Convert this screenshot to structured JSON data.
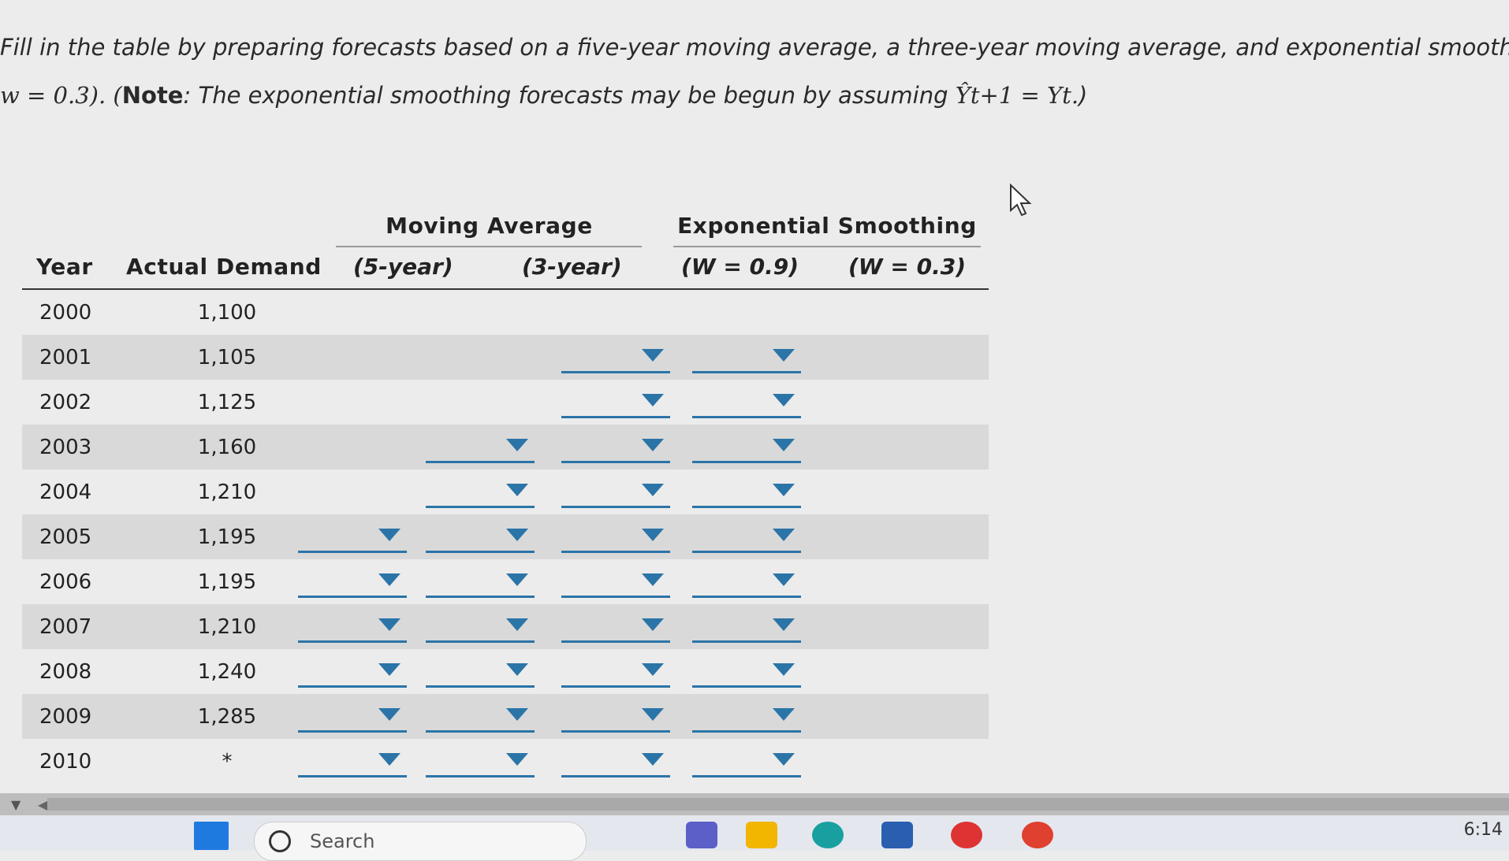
{
  "question": {
    "line1": "Fill in the table by preparing forecasts based on a five-year moving average, a three-year moving average, and exponential smoothing (w =",
    "line2_a": "w = 0.3). (",
    "line2_note": "Note",
    "line2_b": ": The exponential smoothing forecasts may be begun by assuming ",
    "line2_formula": "Ŷt+1 = Yt.",
    "line2_c": ")"
  },
  "table": {
    "group_headers": {
      "moving_average": "Moving Average",
      "exponential_smoothing": "Exponential Smoothing"
    },
    "columns": {
      "year": "Year",
      "demand": "Actual Demand",
      "ma5": "(5-year)",
      "ma3": "(3-year)",
      "es09": "(W = 0.9)",
      "es03": "(W = 0.3)"
    },
    "rows": [
      {
        "year": "2000",
        "demand": "1,100",
        "ma5": false,
        "ma3": false,
        "es09": false,
        "es03": false
      },
      {
        "year": "2001",
        "demand": "1,105",
        "ma5": false,
        "ma3": false,
        "es09": true,
        "es03": true
      },
      {
        "year": "2002",
        "demand": "1,125",
        "ma5": false,
        "ma3": false,
        "es09": true,
        "es03": true
      },
      {
        "year": "2003",
        "demand": "1,160",
        "ma5": false,
        "ma3": true,
        "es09": true,
        "es03": true
      },
      {
        "year": "2004",
        "demand": "1,210",
        "ma5": false,
        "ma3": true,
        "es09": true,
        "es03": true
      },
      {
        "year": "2005",
        "demand": "1,195",
        "ma5": true,
        "ma3": true,
        "es09": true,
        "es03": true
      },
      {
        "year": "2006",
        "demand": "1,195",
        "ma5": true,
        "ma3": true,
        "es09": true,
        "es03": true
      },
      {
        "year": "2007",
        "demand": "1,210",
        "ma5": true,
        "ma3": true,
        "es09": true,
        "es03": true
      },
      {
        "year": "2008",
        "demand": "1,240",
        "ma5": true,
        "ma3": true,
        "es09": true,
        "es03": true
      },
      {
        "year": "2009",
        "demand": "1,285",
        "ma5": true,
        "ma3": true,
        "es09": true,
        "es03": true
      },
      {
        "year": "2010",
        "demand": "*",
        "ma5": true,
        "ma3": true,
        "es09": true,
        "es03": true
      }
    ]
  },
  "taskbar": {
    "search_label": "Search",
    "clock": "6:14"
  },
  "colors": {
    "accent": "#2b74a7",
    "shade": "#d9d9d9"
  },
  "icons": [
    "windows-start-icon",
    "search-icon",
    "teams-icon",
    "file-explorer-icon",
    "edge-icon",
    "store-icon",
    "chrome-icon",
    "cursor-icon"
  ]
}
